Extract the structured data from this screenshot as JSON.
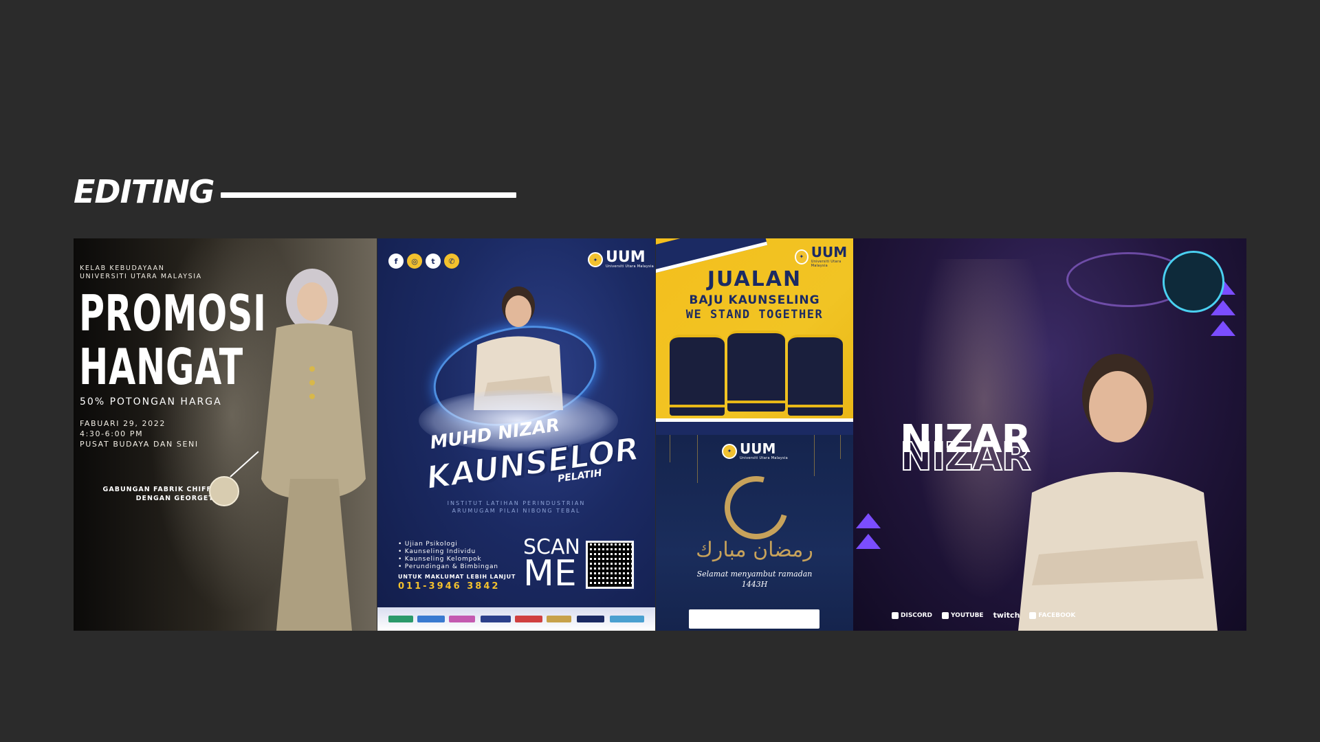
{
  "section": {
    "title": "EDITING"
  },
  "promosi": {
    "club_line1": "KELAB KEBUDAYAAN",
    "club_line2": "UNIVERSITI UTARA MALAYSIA",
    "headline1": "PROMOSI",
    "headline2": "HANGAT",
    "discount": "50% POTONGAN HARGA",
    "date": "FABUARI 29, 2022",
    "time": "4:30-6:00 PM",
    "venue": "PUSAT BUDAYA DAN SENI",
    "fabric_line1": "GABUNGAN FABRIK CHIFFON",
    "fabric_line2": "DENGAN GEORGETTE",
    "colors": {
      "bg": "#0b0a09",
      "dress": "#b9ab8c"
    }
  },
  "kaunselor": {
    "logo": "UUM",
    "logo_sub": "Universiti Utara Malaysia",
    "social_icons": [
      "facebook-icon",
      "instagram-icon",
      "twitter-icon",
      "whatsapp-icon"
    ],
    "name": "MUHD NIZAR",
    "title": "KAUNSELOR",
    "subtitle": "PELATIH",
    "institute_line1": "INSTITUT LATIHAN PERINDUSTRIAN",
    "institute_line2": "ARUMUGAM PILAI NIBONG TEBAL",
    "services": [
      "Ujian Psikologi",
      "Kaunseling Individu",
      "Kaunseling Kelompok",
      "Perundingan & Bimbingan"
    ],
    "info_label": "UNTUK MAKLUMAT LEBIH LANJUT",
    "phone": "011-3946 3842",
    "scan_line1": "SCAN",
    "scan_line2": "ME",
    "colors": {
      "bg": "#1b2a63",
      "accent": "#f3c12d",
      "glow": "#5aa7ff"
    }
  },
  "jualan": {
    "logo": "UUM",
    "logo_sub": "Universiti Utara Malaysia",
    "title": "JUALAN",
    "subtitle": "BAJU KAUNSELING",
    "tagline": "WE STAND TOGETHER",
    "colors": {
      "bg": "#f4bf1d",
      "navy": "#1b2a63"
    }
  },
  "ramadan": {
    "logo": "UUM",
    "logo_sub": "Universiti Utara Malaysia",
    "arabic": "رمضان مبارك",
    "greeting": "Selamat menyambut ramadan",
    "year": "1443H",
    "colors": {
      "bg": "#15244d",
      "gold": "#c7a25b"
    }
  },
  "nizar": {
    "name": "NIZAR",
    "socials": [
      "DISCORD",
      "YOUTUBE",
      "twitch",
      "FACEBOOK"
    ],
    "colors": {
      "bg": "#22163d",
      "accent": "#7b4dff"
    }
  }
}
